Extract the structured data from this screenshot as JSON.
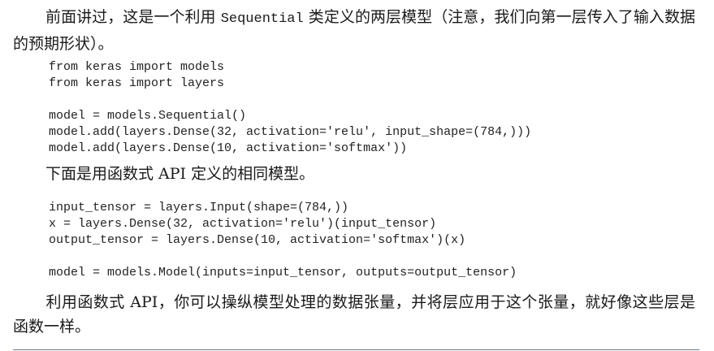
{
  "intro_paragraph": {
    "part1": "前面讲过，这是一个利用 ",
    "code": "Sequential",
    "part2": " 类定义的两层模型（注意，我们向第一层传入了输入数据的预期形状）。"
  },
  "code_block_1": {
    "lines": [
      "from keras import models",
      "from keras import layers",
      "",
      "model = models.Sequential()",
      "model.add(layers.Dense(32, activation='relu', input_shape=(784,)))",
      "model.add(layers.Dense(10, activation='softmax'))"
    ]
  },
  "middle_paragraph": {
    "text": "下面是用函数式 API 定义的相同模型。"
  },
  "code_block_2": {
    "lines": [
      "input_tensor = layers.Input(shape=(784,))",
      "x = layers.Dense(32, activation='relu')(input_tensor)",
      "output_tensor = layers.Dense(10, activation='softmax')(x)",
      "",
      "model = models.Model(inputs=input_tensor, outputs=output_tensor)"
    ]
  },
  "closing_paragraph": {
    "text": "利用函数式 API，你可以操纵模型处理的数据张量，并将层应用于这个张量，就好像这些层是函数一样。"
  }
}
